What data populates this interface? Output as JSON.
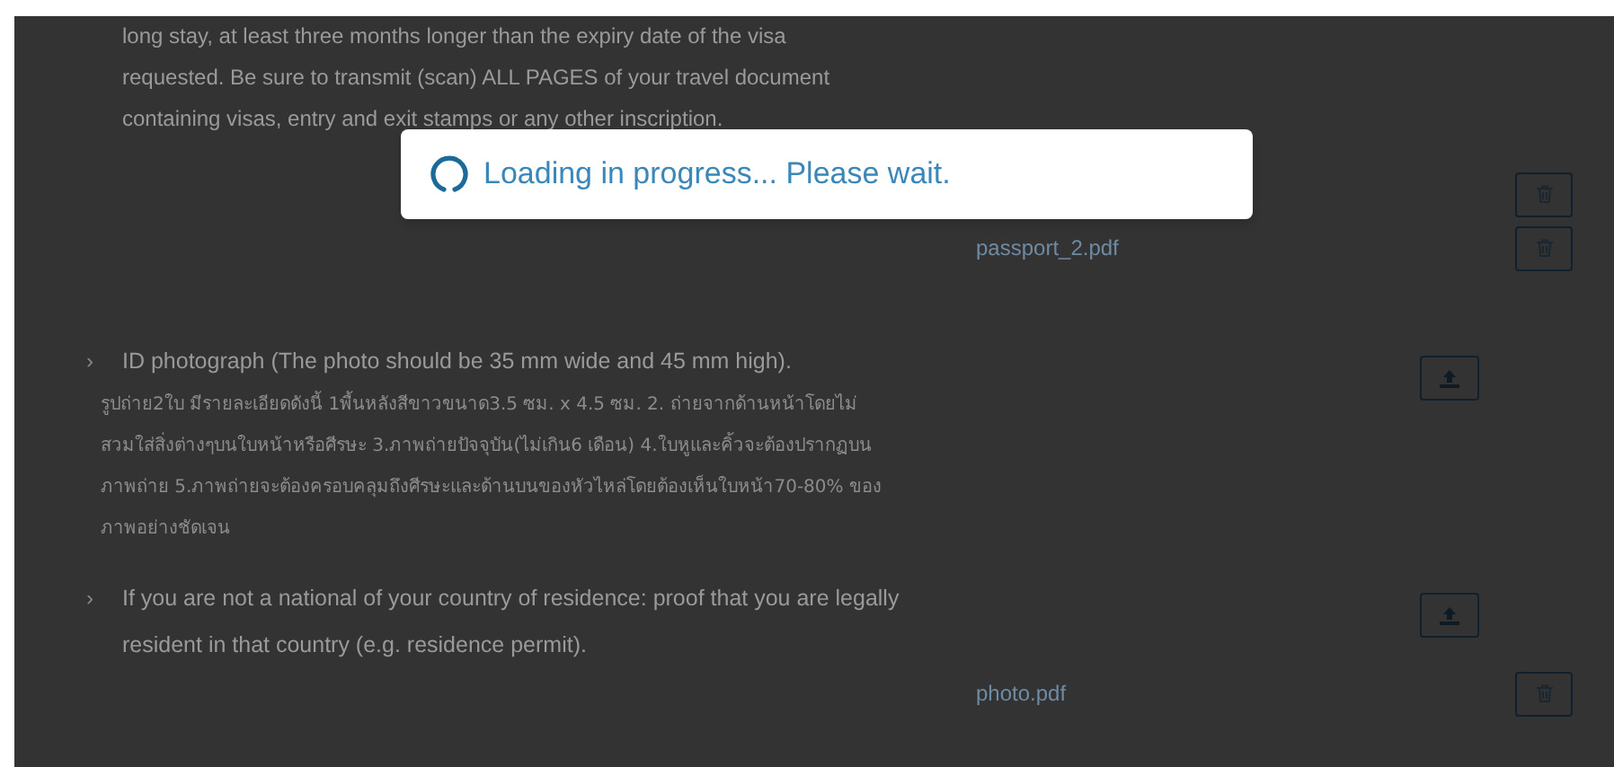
{
  "documents": [
    {
      "text": "long stay, at least three months longer than the expiry date of the visa requested. Be sure to transmit (scan) ALL PAGES of your travel document containing visas, entry and exit stamps or any other inscription.",
      "upload": false,
      "entries": [
        {
          "kind": "delete"
        },
        {
          "kind": "file",
          "name": "passport_2.pdf"
        }
      ]
    },
    {
      "chevron": "›",
      "title": "ID photograph (The photo should be 35 mm wide and 45 mm high).",
      "text": "รูปถ่าย2ใบ มีรายละเอียดดังนี้ 1พื้นหลังสีขาวขนาด3.5 ซม. x 4.5 ซม. 2. ถ่ายจากด้านหน้าโดยไม่สวมใส่สิ่งต่างๆบนใบหน้าหรือศีรษะ 3.ภาพถ่ายปัจจุบัน(ไม่เกิน6 เดือน) 4.ใบหูและคิ้วจะต้องปรากฏบนภาพถ่าย 5.ภาพถ่ายจะต้องครอบคลุมถึงศีรษะและด้านบนของหัวไหล่โดยต้องเห็นใบหน้า70-80% ของภาพอย่างชัดเจน",
      "upload": true
    },
    {
      "chevron": "›",
      "title": "If you are not a national of your country of residence: proof that you are legally resident in that country (e.g. residence permit).",
      "upload": true,
      "entries": [
        {
          "kind": "file",
          "name": "photo.pdf"
        }
      ]
    }
  ],
  "loading": {
    "message": "Loading in progress... Please wait."
  }
}
